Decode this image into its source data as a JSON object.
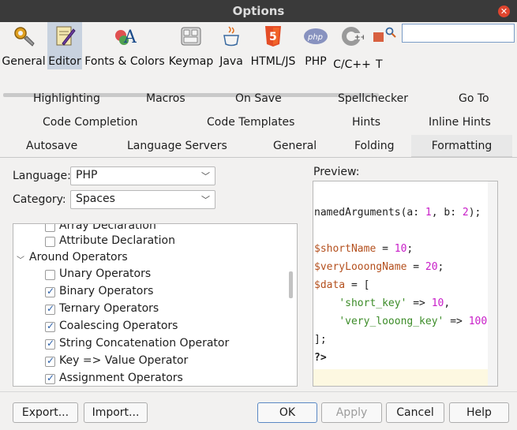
{
  "window": {
    "title": "Options"
  },
  "categories": [
    {
      "label": "General",
      "icon": "general-wrench-icon"
    },
    {
      "label": "Editor",
      "icon": "editor-pencil-icon",
      "selected": true
    },
    {
      "label": "Fonts & Colors",
      "icon": "fonts-colors-icon"
    },
    {
      "label": "Keymap",
      "icon": "keymap-keyboard-icon"
    },
    {
      "label": "Java",
      "icon": "java-cup-icon"
    },
    {
      "label": "HTML/JS",
      "icon": "html5-icon"
    },
    {
      "label": "PHP",
      "icon": "php-icon"
    },
    {
      "label": "C/C++",
      "icon": "cpp-icon"
    },
    {
      "label": "T",
      "icon": "partial-icon"
    }
  ],
  "search": {
    "value": "",
    "placeholder": ""
  },
  "tabs": {
    "row1": [
      "Highlighting",
      "Macros",
      "On Save",
      "Spellchecker",
      "Go To"
    ],
    "row2": [
      "Code Completion",
      "Code Templates",
      "Hints",
      "Inline Hints"
    ],
    "row3": [
      "Autosave",
      "Language Servers",
      "General",
      "Folding",
      "Formatting"
    ],
    "active": "Formatting"
  },
  "form": {
    "language_label": "Language:",
    "language_value": "PHP",
    "category_label": "Category:",
    "category_value": "Spaces"
  },
  "tree": {
    "items": [
      {
        "label": "Array Declaration",
        "type": "check",
        "checked": false
      },
      {
        "label": "Attribute Declaration",
        "type": "check",
        "checked": false
      },
      {
        "label": "Around Operators",
        "type": "group"
      },
      {
        "label": "Unary Operators",
        "type": "check",
        "checked": false
      },
      {
        "label": "Binary Operators",
        "type": "check",
        "checked": true
      },
      {
        "label": "Ternary Operators",
        "type": "check",
        "checked": true
      },
      {
        "label": "Coalescing Operators",
        "type": "check",
        "checked": true
      },
      {
        "label": "String Concatenation Operator",
        "type": "check",
        "checked": true
      },
      {
        "label": "Key => Value Operator",
        "type": "check",
        "checked": true
      },
      {
        "label": "Assignment Operators",
        "type": "check",
        "checked": true
      }
    ]
  },
  "preview": {
    "label": "Preview:",
    "lines": [
      [
        {
          "t": "}",
          "c": "#1e1e1e"
        }
      ],
      [],
      [
        {
          "t": "namedArguments(a: ",
          "c": "#1e1e1e"
        },
        {
          "t": "1",
          "c": "#c81ec8"
        },
        {
          "t": ", b: ",
          "c": "#1e1e1e"
        },
        {
          "t": "2",
          "c": "#c81ec8"
        },
        {
          "t": ");",
          "c": "#1e1e1e"
        }
      ],
      [],
      [
        {
          "t": "$shortName",
          "c": "#b4501e"
        },
        {
          "t": " = ",
          "c": "#1e1e1e"
        },
        {
          "t": "10",
          "c": "#c81ec8"
        },
        {
          "t": ";",
          "c": "#1e1e1e"
        }
      ],
      [
        {
          "t": "$veryLooongName",
          "c": "#b4501e"
        },
        {
          "t": " = ",
          "c": "#1e1e1e"
        },
        {
          "t": "20",
          "c": "#c81ec8"
        },
        {
          "t": ";",
          "c": "#1e1e1e"
        }
      ],
      [
        {
          "t": "$data",
          "c": "#b4501e"
        },
        {
          "t": " = [",
          "c": "#1e1e1e"
        }
      ],
      [
        {
          "t": "    ",
          "c": "#1e1e1e"
        },
        {
          "t": "'short_key'",
          "c": "#3c8c28"
        },
        {
          "t": " => ",
          "c": "#1e1e1e"
        },
        {
          "t": "10",
          "c": "#c81ec8"
        },
        {
          "t": ",",
          "c": "#1e1e1e"
        }
      ],
      [
        {
          "t": "    ",
          "c": "#1e1e1e"
        },
        {
          "t": "'very_looong_key'",
          "c": "#3c8c28"
        },
        {
          "t": " => ",
          "c": "#1e1e1e"
        },
        {
          "t": "100",
          "c": "#c81ec8"
        }
      ],
      [
        {
          "t": "];",
          "c": "#1e1e1e"
        }
      ],
      [
        {
          "t": "?>",
          "c": "#1e1e1e",
          "b": true
        }
      ]
    ]
  },
  "buttons": {
    "export": "Export...",
    "import": "Import...",
    "ok": "OK",
    "apply": "Apply",
    "cancel": "Cancel",
    "help": "Help"
  },
  "colors": {
    "titlebar": "#3a3a3a",
    "selected_category": "#c8d2df",
    "close": "#e0452e",
    "accent_border": "#5a88c4"
  }
}
